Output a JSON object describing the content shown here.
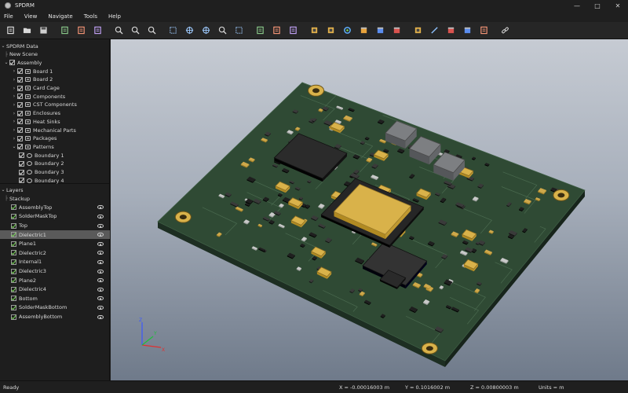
{
  "window": {
    "title": "SPDRM",
    "controls": [
      "—",
      "□",
      "✕"
    ]
  },
  "menu": [
    "File",
    "View",
    "Navigate",
    "Tools",
    "Help"
  ],
  "toolbar": {
    "icons": [
      "new-file-icon",
      "open-folder-icon",
      "save-icon",
      "sep",
      "import-icon",
      "export-icon",
      "report-icon",
      "sep",
      "zoom-fit-icon",
      "zoom-in-icon",
      "zoom-out-icon",
      "sep",
      "select-icon",
      "pan-icon",
      "rotate-icon",
      "zoom-box-icon",
      "fit-icon",
      "sep",
      "view-front-icon",
      "view-top-icon",
      "view-side-icon",
      "sep",
      "layer-icon",
      "mesh-icon",
      "refresh-icon",
      "color-orange-icon",
      "color-blue-icon",
      "color-red-icon",
      "sep",
      "probe-icon",
      "brush-icon",
      "cube-red-icon",
      "cube-blue-icon",
      "export-arrow-icon",
      "sep",
      "link-icon"
    ]
  },
  "tree": {
    "root": "SPDRM Data",
    "new_scene": "New Scene",
    "assembly": "Assembly",
    "items": [
      "Board 1",
      "Board 2",
      "Card Cage",
      "Components",
      "CST Components",
      "Enclosures",
      "Heat Sinks",
      "Mechanical Parts",
      "Packages",
      "Patterns"
    ],
    "boundaries": [
      "Boundary 1",
      "Boundary 2",
      "Boundary 3",
      "Boundary 4"
    ]
  },
  "layers": {
    "header": "Layers",
    "stackup": "Stackup",
    "items": [
      "AssemblyTop",
      "SolderMaskTop",
      "Top",
      "Dielectric1",
      "Plane1",
      "Dielectric2",
      "Internal1",
      "Dielectric3",
      "Plane2",
      "Dielectric4",
      "Bottom",
      "SolderMaskBottom",
      "AssemblyBottom"
    ],
    "selected_index": 3
  },
  "axes": {
    "x": "X",
    "y": "Y",
    "z": "Z"
  },
  "status": {
    "ready": "Ready",
    "x": "X = -0.00016003 m",
    "y": "Y = 0.1016002 m",
    "z": "Z = 0.00800003 m",
    "units": "Units = m"
  },
  "colors": {
    "board": "#2f4a34",
    "board_edge": "#1d2e22",
    "gold": "#d9b24a",
    "chip": "#2b2b2b"
  }
}
